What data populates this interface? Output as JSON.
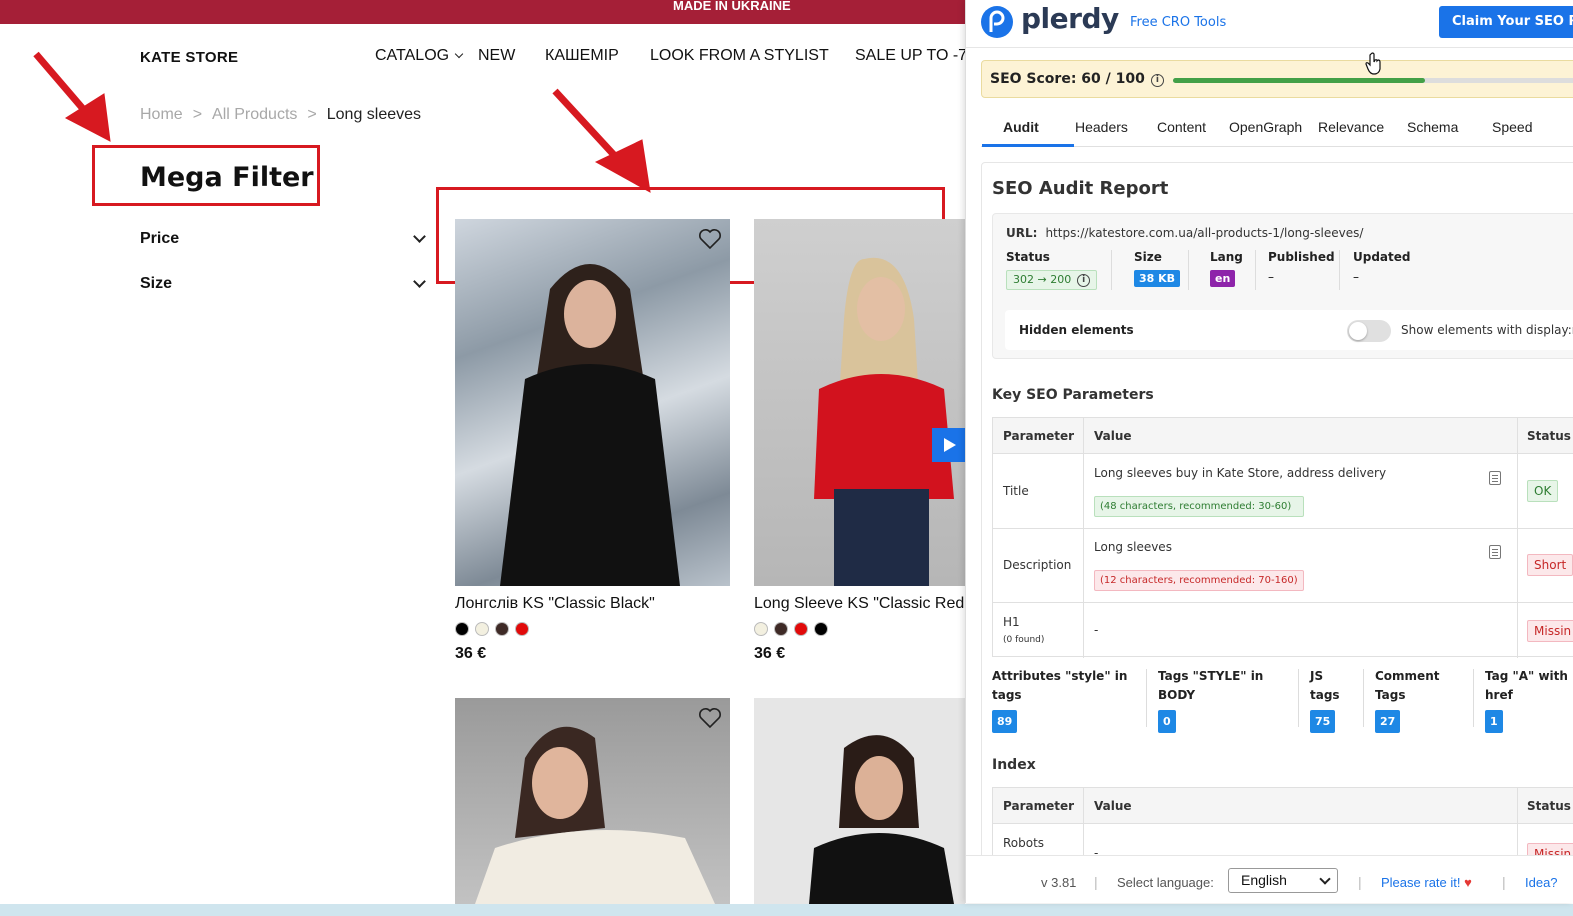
{
  "store": {
    "banner": "MADE IN UKRAINE",
    "logo": "KATE STORE",
    "nav": [
      "CATALOG",
      "NEW",
      "КАШЕМІР",
      "LOOK FROM A STYLIST",
      "SALE UP TO -7"
    ],
    "breadcrumb": {
      "home": "Home",
      "sep": ">",
      "all": "All Products",
      "current": "Long sleeves"
    },
    "filter_title": "Mega Filter",
    "filters": [
      "Price",
      "Size"
    ],
    "products": [
      {
        "name": "Лонгслів KS \"Classic Black\"",
        "price": "36 €",
        "swatches": [
          "#000000",
          "#f3f0e0",
          "#3e2a26",
          "#e10a0a"
        ]
      },
      {
        "name": "Long Sleeve KS \"Classic Red",
        "price": "36 €",
        "swatches": [
          "#f3f0e0",
          "#3e2a26",
          "#e10a0a",
          "#000000"
        ]
      }
    ]
  },
  "plerdy": {
    "brand": "plerdy",
    "free_tools": "Free CRO Tools",
    "claim": "Claim Your SEO Re",
    "seo_score": "SEO Score: 60 / 100",
    "seo_score_value": 0.6,
    "tabs": [
      "Audit",
      "Headers",
      "Content",
      "OpenGraph",
      "Relevance",
      "Schema",
      "Speed"
    ],
    "report_title": "SEO Audit Report",
    "url_label": "URL:",
    "url": "https://katestore.com.ua/all-products-1/long-sleeves/",
    "meta": {
      "status_label": "Status",
      "status_value": "302 → 200",
      "size_label": "Size",
      "size_value": "38 KB",
      "lang_label": "Lang",
      "lang_value": "en",
      "published_label": "Published",
      "published_value": "–",
      "updated_label": "Updated",
      "updated_value": "–"
    },
    "hidden_elements": "Hidden elements",
    "show_elements": "Show elements with display:n",
    "key_params_title": "Key SEO Parameters",
    "table_headers": {
      "parameter": "Parameter",
      "value": "Value",
      "status": "Status"
    },
    "rows": {
      "title": {
        "param": "Title",
        "value": "Long sleeves buy in Kate Store, address delivery",
        "hint": "(48 characters, recommended: 30-60)",
        "status": "OK"
      },
      "description": {
        "param": "Description",
        "value": "Long sleeves",
        "hint": "(12 characters, recommended: 70-160)",
        "status": "Short"
      },
      "h1": {
        "param": "H1",
        "sub": "(0 found)",
        "value": "-",
        "status": "Missin"
      }
    },
    "counts": [
      {
        "label": "Attributes \"style\" in tags",
        "value": "89"
      },
      {
        "label": "Tags \"STYLE\" in BODY",
        "value": "0"
      },
      {
        "label": "JS tags",
        "value": "75"
      },
      {
        "label": "Comment Tags",
        "value": "27"
      },
      {
        "label": "Tag \"A\" with href",
        "value": "1"
      }
    ],
    "index_title": "Index",
    "index_rows": {
      "robots": {
        "param": "Robots",
        "value": "-",
        "status": "Missin"
      }
    },
    "footer": {
      "version": "v 3.81",
      "select_language": "Select language:",
      "language": "English",
      "rate": "Please rate it!",
      "idea": "Idea?"
    }
  }
}
